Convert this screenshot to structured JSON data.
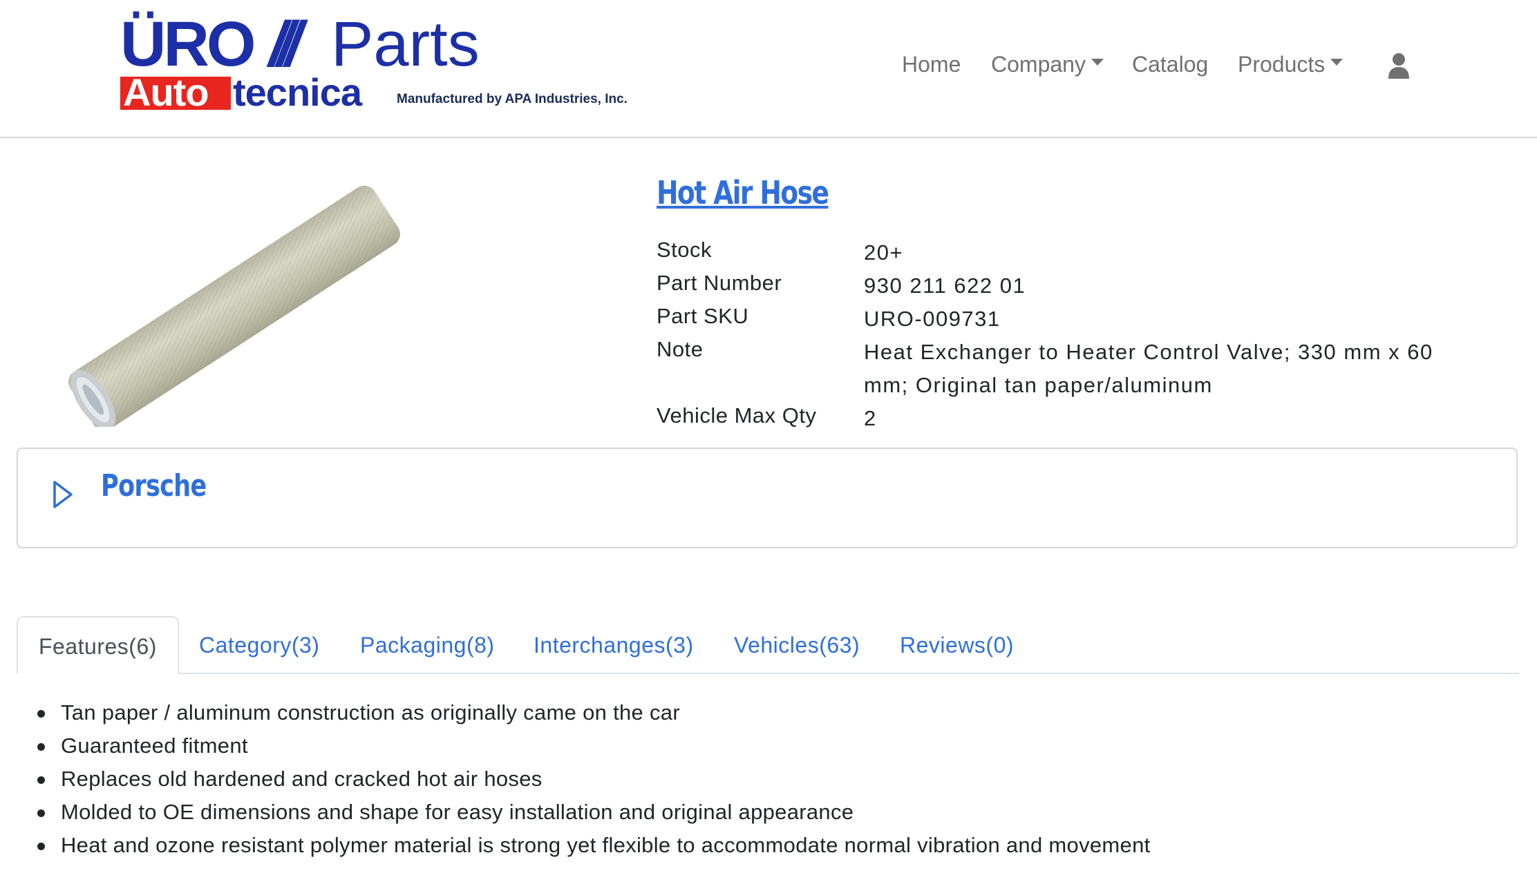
{
  "header": {
    "logo": {
      "line1_uro": "ÜRO",
      "line1_parts": "Parts",
      "line2_auto": "Auto",
      "line2_tecnica": "tecnica",
      "manufacturer": "Manufactured by APA Industries, Inc."
    },
    "nav": [
      {
        "label": "Home",
        "dropdown": false
      },
      {
        "label": "Company",
        "dropdown": true
      },
      {
        "label": "Catalog",
        "dropdown": false
      },
      {
        "label": "Products",
        "dropdown": true
      }
    ],
    "user_icon": "user-icon"
  },
  "product": {
    "title": "Hot Air Hose",
    "image_icon": "hot-air-hose-image",
    "specs": [
      {
        "label": "Stock",
        "value": "20+"
      },
      {
        "label": "Part Number",
        "value": "930 211 622 01"
      },
      {
        "label": "Part SKU",
        "value": "URO-009731"
      },
      {
        "label": "Note",
        "value": "Heat Exchanger to Heater Control Valve; 330 mm x 60 mm; Original tan paper/aluminum"
      },
      {
        "label": "Vehicle Max Qty",
        "value": "2"
      }
    ]
  },
  "accordion": {
    "title": "Porsche",
    "icon": "play-triangle-icon"
  },
  "tabs": [
    {
      "label": "Features",
      "count": "(6)",
      "active": true
    },
    {
      "label": "Category",
      "count": "(3)",
      "active": false
    },
    {
      "label": "Packaging",
      "count": "(8)",
      "active": false
    },
    {
      "label": "Interchanges",
      "count": "(3)",
      "active": false
    },
    {
      "label": "Vehicles",
      "count": "(63)",
      "active": false
    },
    {
      "label": "Reviews",
      "count": "(0)",
      "active": false
    }
  ],
  "features": [
    "Tan paper / aluminum construction as originally came on the car",
    "Guaranteed fitment",
    "Replaces old hardened and cracked hot air hoses",
    "Molded to OE dimensions and shape for easy installation and original appearance",
    "Heat and ozone resistant polymer material is strong yet flexible to accommodate normal vibration and movement"
  ],
  "colors": {
    "link": "#2f6fdb",
    "logo_blue": "#1c2fa6",
    "logo_red": "#e8251f",
    "nav_text": "#707070"
  }
}
